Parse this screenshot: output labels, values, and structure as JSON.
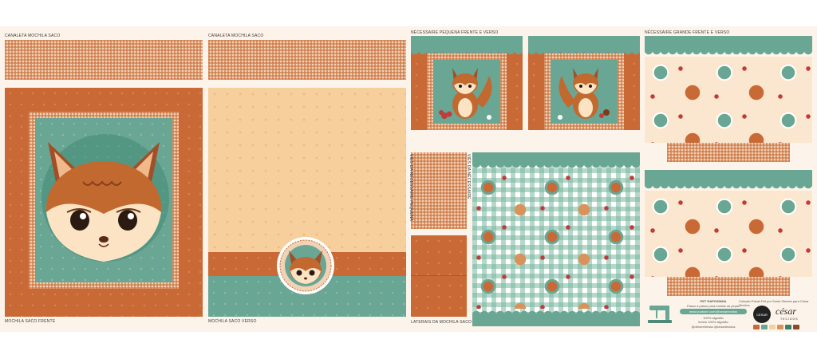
{
  "labels": {
    "alca_left": "CANALETA MOCHILA SACO",
    "alca_right": "CANALETA MOCHILA SACO",
    "frente": "MOCHILA SACO FRENTE",
    "verso": "MOCHILA SACO VERSO",
    "necessaire_pequena": "NÉCESSAIRE PEQUENA FRENTE E VERSO",
    "necessaire_grande": "NÉCESSAIRE GRANDE FRENTE E VERSO",
    "laterais": "LATERAIS DA MOCHILA SACO",
    "vies_a": "VIÉS DA NÉCESSAIRE PEQUENA",
    "vies_b": "VIÉS DA NÉCESSAIRE"
  },
  "footer": {
    "title": "PET RAPOSINHA",
    "line1": "Passo a passo para montar as peças",
    "pill": "www.youtube.com/@cesartecidos",
    "line2": "100% algodão",
    "line3": "tecido 100% algodão",
    "social": "@dimoretirmao   @cesartecidos",
    "collection": "Coleção Painel Pet por Sonia Simoes para César Tecidos",
    "brand": "césar",
    "brand_sub": "TECIDOS",
    "badge": "CESAR",
    "swatches": [
      "#c96a36",
      "#6aa694",
      "#f6cf9d",
      "#d9935a",
      "#3a7d6a",
      "#8a4a2a"
    ]
  },
  "colors": {
    "orange": "#c96a36",
    "teal": "#6aa694",
    "peach": "#f6cf9d",
    "cream": "#fcf4ea"
  }
}
